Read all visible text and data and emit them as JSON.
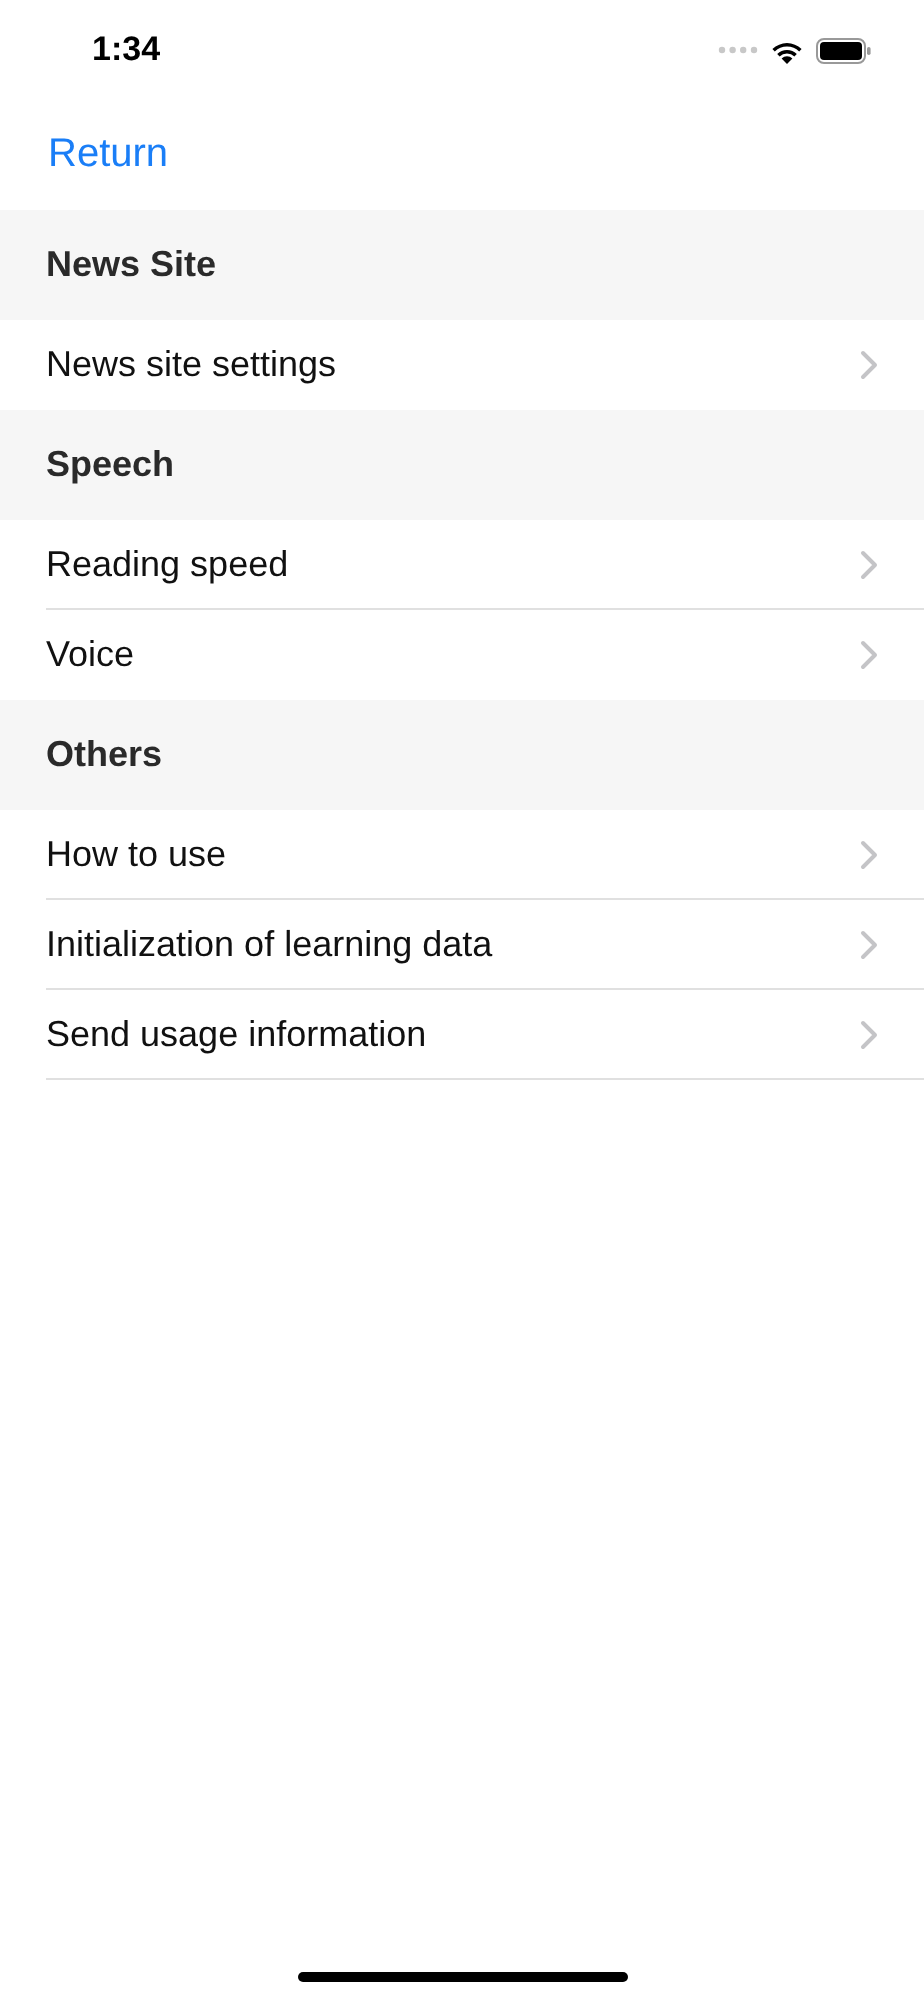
{
  "status_bar": {
    "time": "1:34"
  },
  "nav_bar": {
    "back_label": "Return"
  },
  "sections": [
    {
      "title": "News Site",
      "rows": [
        {
          "label": "News site settings"
        }
      ]
    },
    {
      "title": "Speech",
      "rows": [
        {
          "label": "Reading speed"
        },
        {
          "label": "Voice"
        }
      ]
    },
    {
      "title": "Others",
      "rows": [
        {
          "label": "How to use"
        },
        {
          "label": "Initialization of learning data"
        },
        {
          "label": "Send usage information"
        }
      ]
    }
  ]
}
